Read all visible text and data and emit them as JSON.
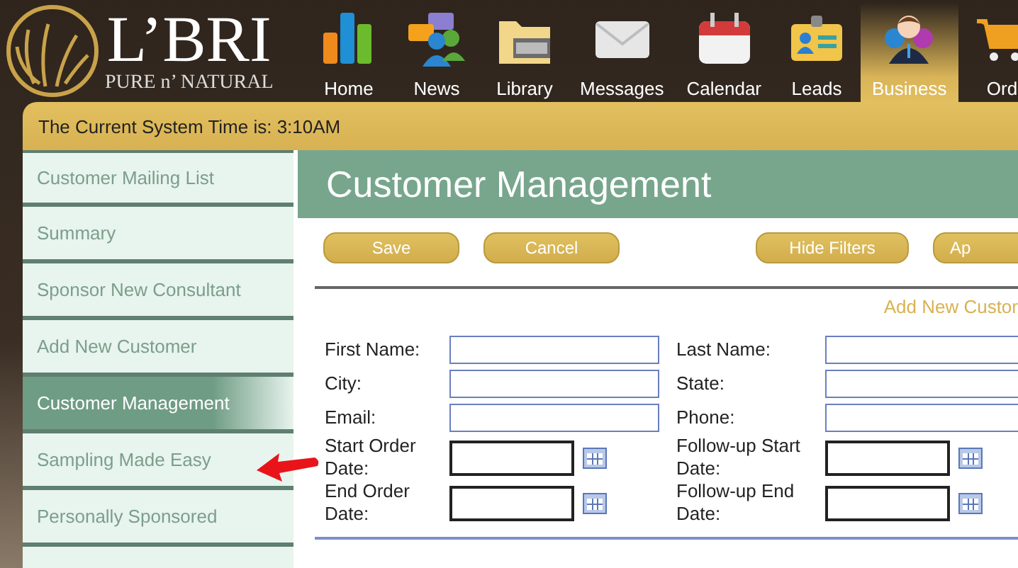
{
  "logo": {
    "name": "L’BRI",
    "tagline": "PURE n’ NATURAL"
  },
  "nav": [
    {
      "label": "Home",
      "selected": false
    },
    {
      "label": "News",
      "selected": false
    },
    {
      "label": "Library",
      "selected": false
    },
    {
      "label": "Messages",
      "selected": false
    },
    {
      "label": "Calendar",
      "selected": false
    },
    {
      "label": "Leads",
      "selected": false
    },
    {
      "label": "Business",
      "selected": true
    },
    {
      "label": "Ord",
      "selected": false
    }
  ],
  "status": "The Current System Time is: 3:10AM",
  "sidebar": {
    "items": [
      {
        "label": "Customer Mailing List",
        "selected": false
      },
      {
        "label": "Summary",
        "selected": false
      },
      {
        "label": "Sponsor New Consultant",
        "selected": false
      },
      {
        "label": "Add New Customer",
        "selected": false
      },
      {
        "label": "Customer Management",
        "selected": true
      },
      {
        "label": "Sampling Made Easy",
        "selected": false
      },
      {
        "label": "Personally Sponsored",
        "selected": false
      }
    ]
  },
  "page": {
    "title": "Customer Management",
    "buttons_left": [
      "Save",
      "Cancel"
    ],
    "buttons_right": [
      "Hide Filters",
      "Ap"
    ],
    "link": "Add New Custor",
    "fields": [
      {
        "label": "First Name:",
        "kind": "text"
      },
      {
        "label": "Last Name:",
        "kind": "text"
      },
      {
        "label": "City:",
        "kind": "text"
      },
      {
        "label": "State:",
        "kind": "text"
      },
      {
        "label": "Email:",
        "kind": "text"
      },
      {
        "label": "Phone:",
        "kind": "text"
      },
      {
        "label": "Start Order Date:",
        "kind": "date"
      },
      {
        "label": "Follow-up Start Date:",
        "kind": "date"
      },
      {
        "label": "End Order Date:",
        "kind": "date"
      },
      {
        "label": "Follow-up End Date:",
        "kind": "date"
      }
    ]
  }
}
